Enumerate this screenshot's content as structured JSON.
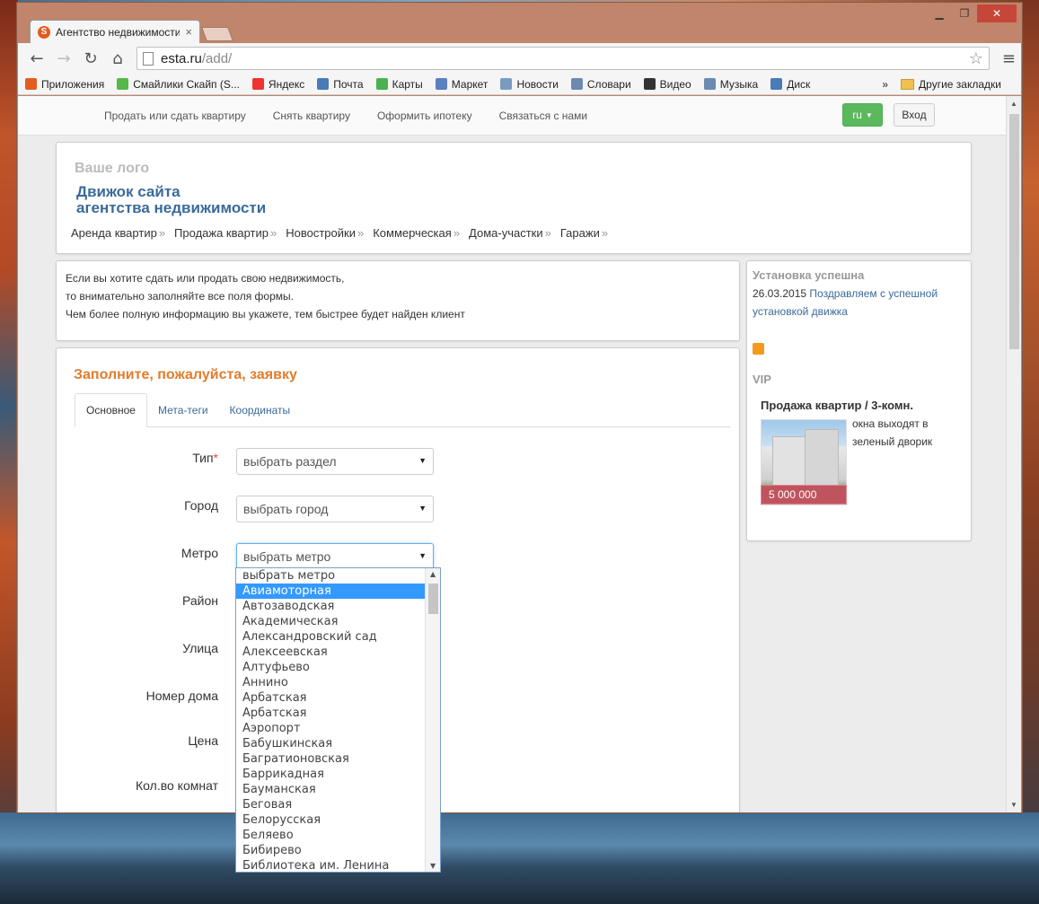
{
  "browser": {
    "tab_title": "Агентство недвижимости",
    "tab_favicon": "S",
    "url_host": "esta.ru",
    "url_path": "/add/",
    "bookmarks": [
      {
        "label": "Приложения",
        "color": "#e25c1e"
      },
      {
        "label": "Смайлики Скайп (S...",
        "color": "#55b948"
      },
      {
        "label": "Яндекс",
        "color": "#e33"
      },
      {
        "label": "Почта",
        "color": "#4a7ab8"
      },
      {
        "label": "Карты",
        "color": "#4caf50"
      },
      {
        "label": "Маркет",
        "color": "#5b7fbf"
      },
      {
        "label": "Новости",
        "color": "#7a9ac0"
      },
      {
        "label": "Словари",
        "color": "#6a8ab0"
      },
      {
        "label": "Видео",
        "color": "#333333"
      },
      {
        "label": "Музыка",
        "color": "#6a8ab0"
      },
      {
        "label": "Диск",
        "color": "#4a7ab8"
      }
    ],
    "bookmarks_more": "»",
    "other_bookmarks": "Другие закладки"
  },
  "site": {
    "topnav": [
      "Продать или сдать квартиру",
      "Снять квартиру",
      "Оформить ипотеку",
      "Связаться с нами"
    ],
    "lang": "ru",
    "login": "Вход",
    "logo_placeholder": "Ваше лого",
    "title_line1": "Движок сайта",
    "title_line2": "агентства недвижимости",
    "mainnav": [
      "Аренда квартир",
      "Продажа квартир",
      "Новостройки",
      "Коммерческая",
      "Дома-участки",
      "Гаражи"
    ],
    "raquo": "»"
  },
  "info": {
    "line1": "Если вы хотите сдать или продать свою недвижимость,",
    "line2": "то внимательно заполняйте все поля формы.",
    "line3": "Чем более полную информацию вы укажете, тем быстрее будет найден клиент"
  },
  "sidebar": {
    "news_heading": "Установка успешна",
    "news_date": "26.03.2015",
    "news_link": "Поздравляем с успешной установкой движка",
    "vip_heading": "VIP",
    "vip_title": "Продажа квартир / 3-комн.",
    "vip_desc": "окна выходят в зеленый дворик",
    "vip_price": "5 000 000"
  },
  "form": {
    "title": "Заполните, пожалуйста, заявку",
    "tabs": [
      "Основное",
      "Мета-теги",
      "Координаты"
    ],
    "fields": {
      "type_label": "Тип",
      "type_required": "*",
      "type_value": "выбрать раздел",
      "city_label": "Город",
      "city_value": "выбрать город",
      "metro_label": "Метро",
      "metro_value": "выбрать метро",
      "district_label": "Район",
      "street_label": "Улица",
      "house_label": "Номер дома",
      "price_label": "Цена",
      "rooms_label": "Кол.во комнат"
    }
  },
  "metro_options": [
    "выбрать метро",
    "Авиамоторная",
    "Автозаводская",
    "Академическая",
    "Александровский сад",
    "Алексеевская",
    "Алтуфьево",
    "Аннино",
    "Арбатская",
    "Арбатская",
    "Аэропорт",
    "Бабушкинская",
    "Багратионовская",
    "Баррикадная",
    "Бауманская",
    "Беговая",
    "Белорусская",
    "Беляево",
    "Бибирево",
    "Библиотека им. Ленина"
  ],
  "metro_selected": "Авиамоторная"
}
